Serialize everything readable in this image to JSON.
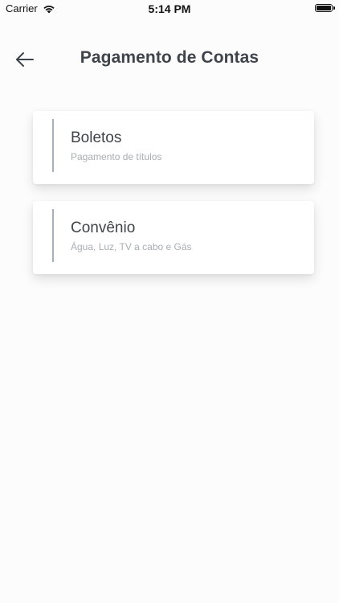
{
  "status_bar": {
    "carrier": "Carrier",
    "time": "5:14 PM",
    "wifi_icon": "wifi-icon",
    "battery_icon": "battery-icon"
  },
  "header": {
    "back_icon": "arrow-left-icon",
    "title": "Pagamento de Contas"
  },
  "options": [
    {
      "title": "Boletos",
      "subtitle": "Pagamento de títulos"
    },
    {
      "title": "Convênio",
      "subtitle": "Água, Luz, TV a cabo e Gás"
    }
  ],
  "colors": {
    "background": "#fcfcfc",
    "card": "#ffffff",
    "accent_bar": "#a7b1bb",
    "title_text": "#3f434a",
    "subtitle_text": "#a9aeb3"
  }
}
